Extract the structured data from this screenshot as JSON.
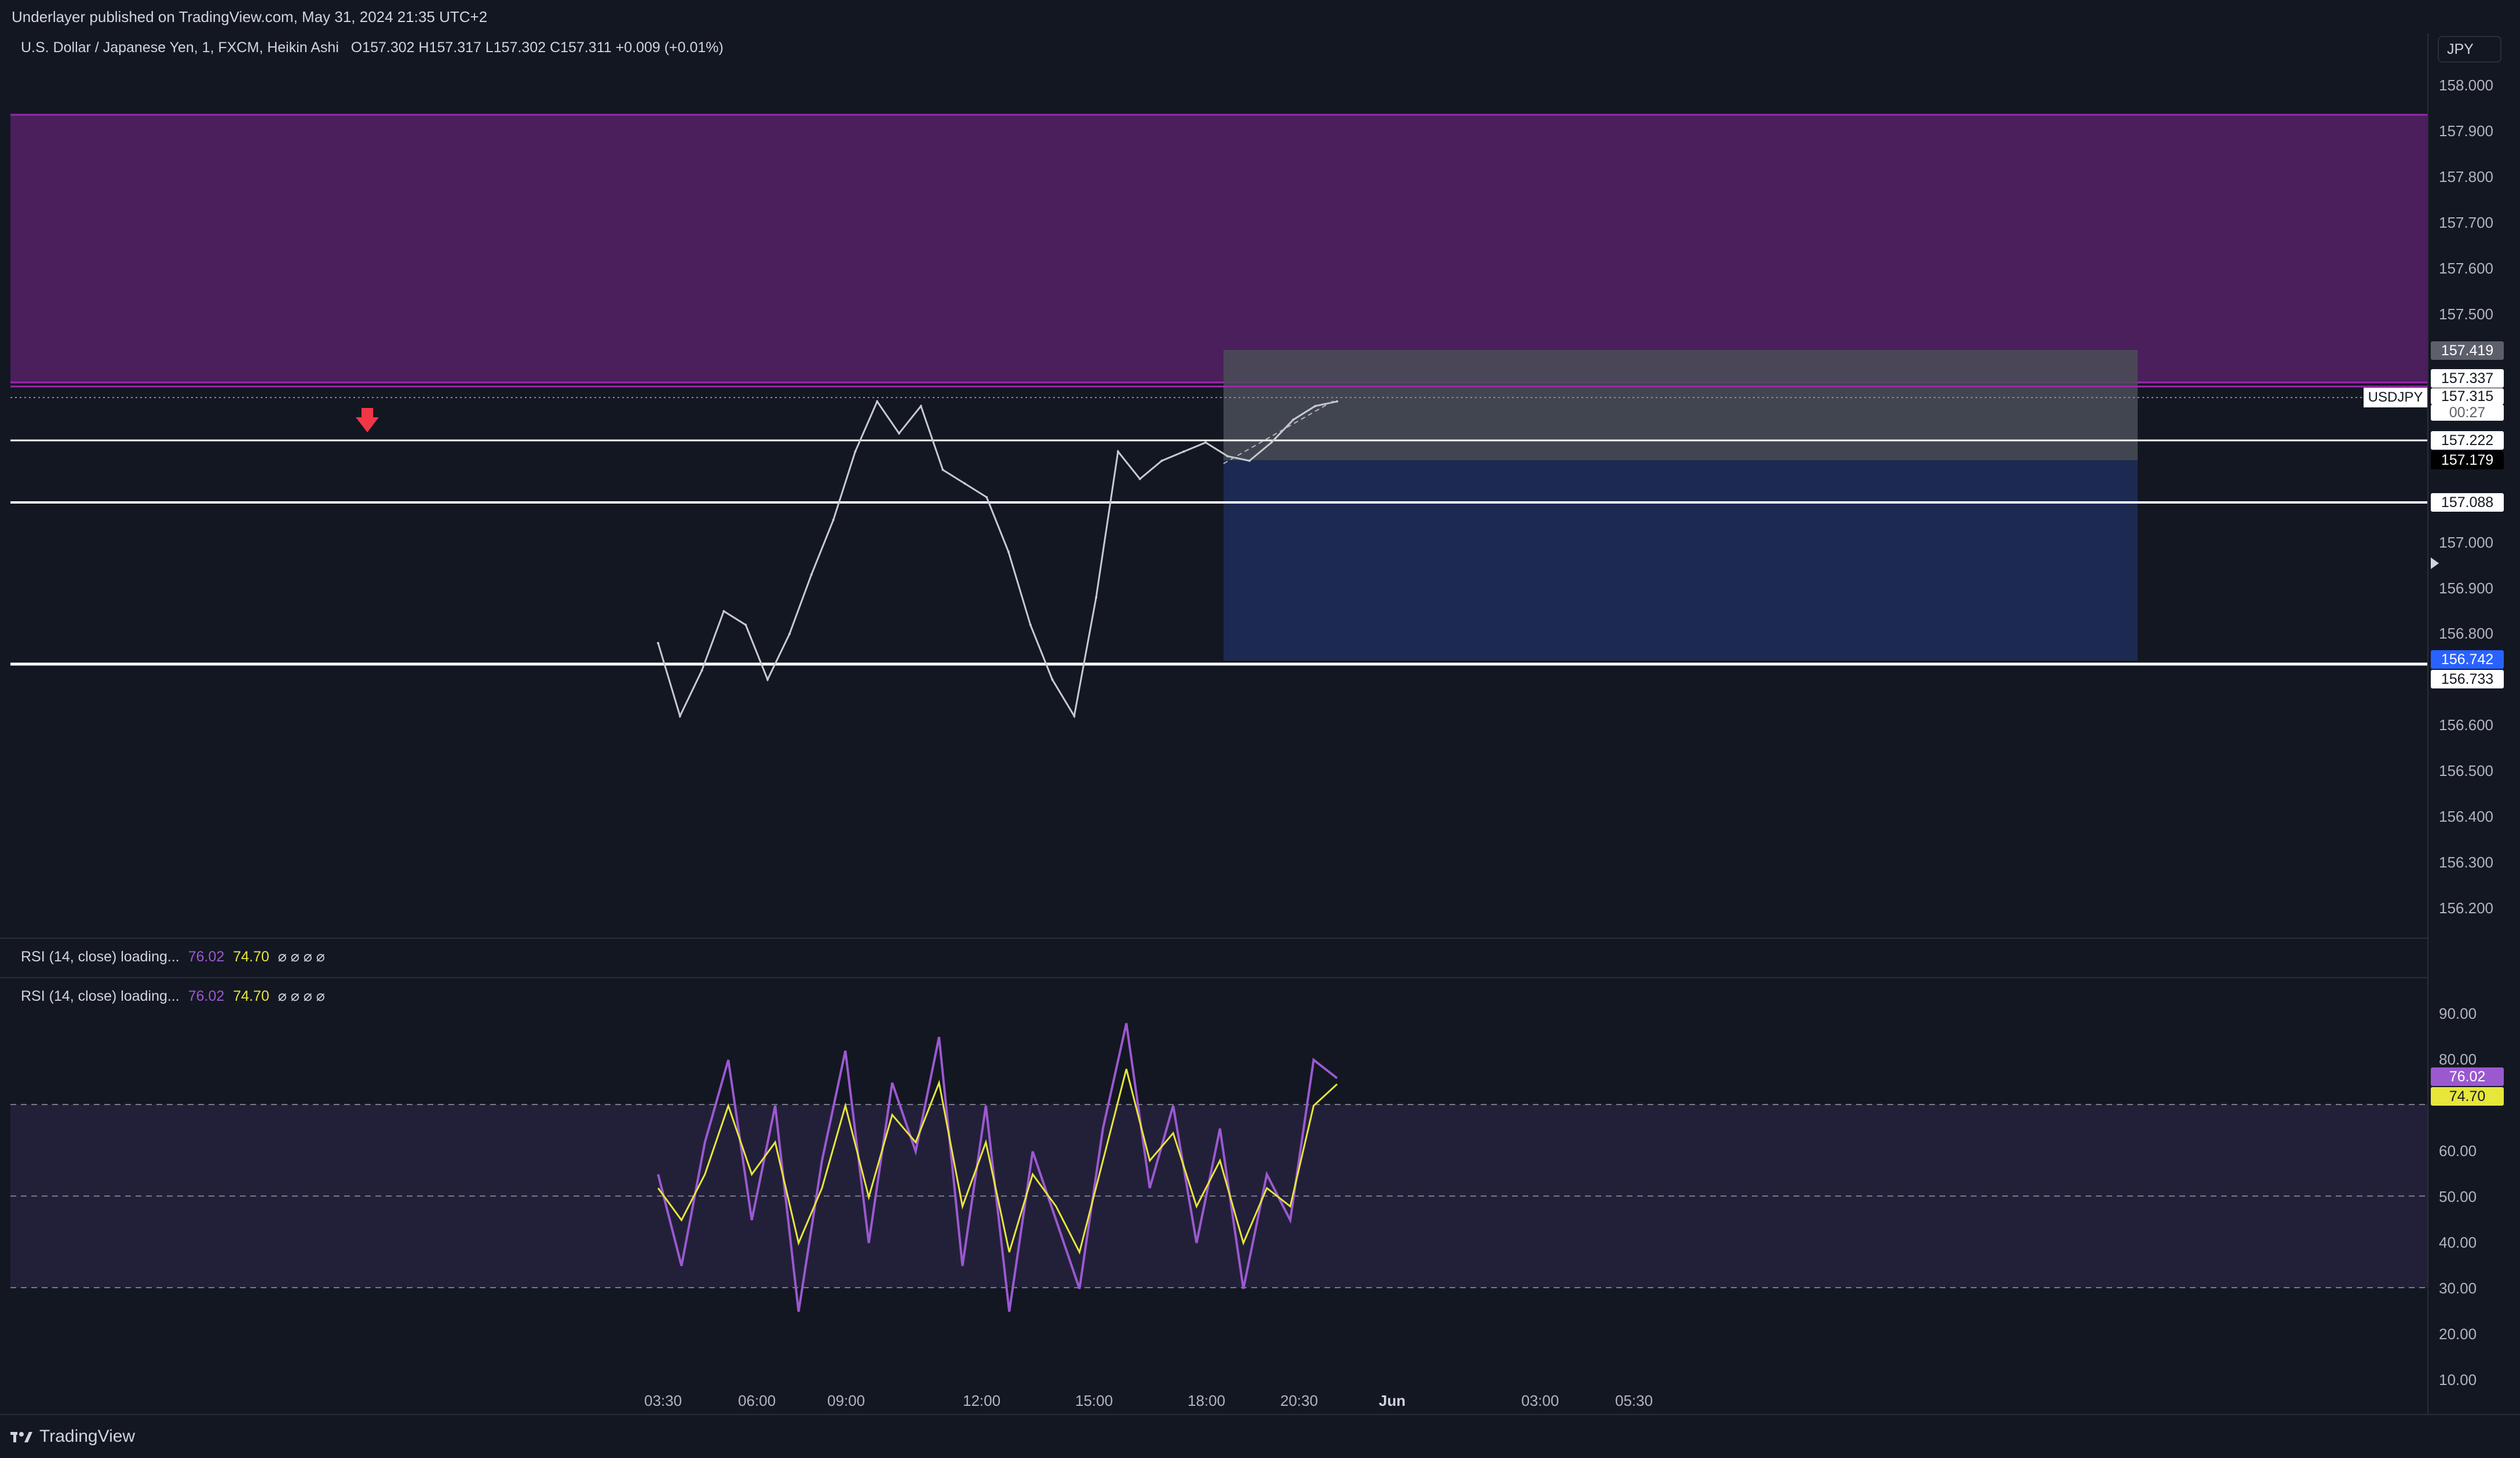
{
  "header": {
    "published_text": "Underlayer published on TradingView.com, May 31, 2024 21:35 UTC+2"
  },
  "main_legend": {
    "symbol_desc": "U.S. Dollar / Japanese Yen, 1, FXCM, Heikin Ashi",
    "ohlc": "O157.302  H157.317  L157.302  C157.311  +0.009 (+0.01%)"
  },
  "currency_badge": "JPY",
  "price_axis_ticks": [
    "158.000",
    "157.900",
    "157.800",
    "157.700",
    "157.600",
    "157.500",
    "157.000",
    "156.900",
    "156.800",
    "156.600",
    "156.500",
    "156.400",
    "156.300",
    "156.200"
  ],
  "price_tags": {
    "zone_top": "157.419",
    "level_a": "157.337",
    "current": "157.315",
    "countdown": "00:27",
    "level_b": "157.222",
    "entry": "157.179",
    "level_c": "157.088",
    "target": "156.742",
    "level_d": "156.733"
  },
  "symbol_tag": "USDJPY",
  "rsi_legend_1": {
    "name": "RSI (14, close) loading...",
    "val1": "76.02",
    "val2": "74.70",
    "nulls": "⌀ ⌀ ⌀ ⌀"
  },
  "rsi_legend_2": {
    "name": "RSI (14, close) loading...",
    "val1": "76.02",
    "val2": "74.70",
    "nulls": "⌀ ⌀ ⌀ ⌀"
  },
  "rsi_axis_ticks": [
    "90.00",
    "80.00",
    "60.00",
    "50.00",
    "40.00",
    "30.00",
    "20.00",
    "10.00"
  ],
  "rsi_tags": {
    "rsi": "76.02",
    "ma": "74.70"
  },
  "time_axis": [
    "03:30",
    "06:00",
    "09:00",
    "12:00",
    "15:00",
    "18:00",
    "20:30",
    "Jun",
    "03:00",
    "05:30"
  ],
  "footer": {
    "brand": "TradingView"
  },
  "colors": {
    "background": "#131722",
    "supply_zone": "#4a1f5c",
    "supply_border": "#9c27b0",
    "profit_zone": "#1c2a52",
    "loss_zone": "#4a4d57",
    "rsi_line": "#9b59d0",
    "rsi_ma": "#e6e63b",
    "arrow": "#f23645",
    "target_tag": "#2962ff"
  },
  "chart_data": {
    "type": "line",
    "title": "U.S. Dollar / Japanese Yen, 1, FXCM, Heikin Ashi",
    "ylim": [
      156.15,
      158.05
    ],
    "x": [
      "03:30",
      "04:30",
      "05:30",
      "06:00",
      "07:00",
      "08:00",
      "09:00",
      "09:30",
      "10:00",
      "10:30",
      "11:00",
      "11:30",
      "12:00",
      "12:30",
      "13:00",
      "13:30",
      "14:00",
      "14:30",
      "15:00",
      "15:30",
      "16:00",
      "16:30",
      "17:00",
      "17:30",
      "18:00",
      "18:30",
      "19:00",
      "19:30",
      "20:00",
      "20:30",
      "21:00",
      "21:20"
    ],
    "series": [
      {
        "name": "USDJPY",
        "values": [
          156.78,
          156.62,
          156.72,
          156.85,
          156.82,
          156.7,
          156.8,
          156.93,
          157.05,
          157.2,
          157.31,
          157.24,
          157.3,
          157.16,
          157.13,
          157.1,
          156.98,
          156.82,
          156.7,
          156.62,
          156.88,
          157.2,
          157.14,
          157.18,
          157.2,
          157.22,
          157.19,
          157.18,
          157.22,
          157.27,
          157.3,
          157.31
        ]
      }
    ],
    "levels": [
      157.419,
      157.337,
      157.222,
      157.179,
      157.088,
      156.742,
      156.733
    ],
    "rsi": {
      "ylim": [
        5,
        95
      ],
      "bands": [
        70,
        50,
        30
      ],
      "series": [
        {
          "name": "RSI",
          "values": [
            55,
            35,
            62,
            80,
            45,
            70,
            25,
            58,
            82,
            40,
            75,
            60,
            85,
            35,
            70,
            25,
            60,
            45,
            30,
            65,
            88,
            52,
            70,
            40,
            65,
            30,
            55,
            45,
            80,
            76
          ]
        },
        {
          "name": "MA",
          "values": [
            52,
            45,
            55,
            70,
            55,
            62,
            40,
            52,
            70,
            50,
            68,
            62,
            75,
            48,
            62,
            38,
            55,
            48,
            38,
            58,
            78,
            58,
            64,
            48,
            58,
            40,
            52,
            48,
            70,
            74.7
          ]
        }
      ]
    }
  }
}
